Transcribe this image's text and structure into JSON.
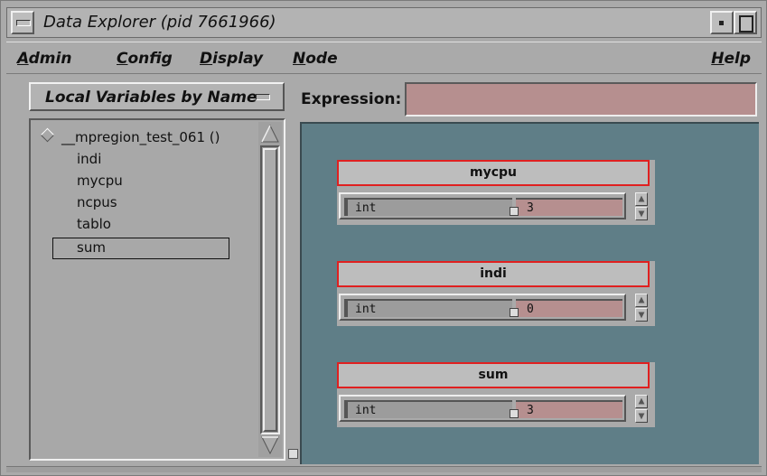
{
  "window": {
    "title": "Data Explorer (pid 7661966)"
  },
  "menubar": {
    "items": [
      {
        "mnemonic": "A",
        "rest": "dmin"
      },
      {
        "mnemonic": "C",
        "rest": "onfig"
      },
      {
        "mnemonic": "D",
        "rest": "isplay"
      },
      {
        "mnemonic": "N",
        "rest": "ode"
      },
      {
        "mnemonic": "H",
        "rest": "elp"
      }
    ]
  },
  "variables_panel": {
    "view_selector": "Local Variables by Name",
    "tree": {
      "root": "__mpregion_test_061 ()",
      "children": [
        "indi",
        "mycpu",
        "ncpus",
        "tablo",
        "sum"
      ],
      "selected": "sum"
    }
  },
  "expression": {
    "label": "Expression:",
    "value": ""
  },
  "watch_widgets": [
    {
      "name": "mycpu",
      "type": "int",
      "value": "3"
    },
    {
      "name": "indi",
      "type": "int",
      "value": "0"
    },
    {
      "name": "sum",
      "type": "int",
      "value": "3"
    }
  ],
  "icons": {
    "window_menu": "window-menu-icon",
    "minimize": "minimize-icon",
    "maximize": "maximize-icon",
    "tree_expand": "diamond-expand-icon",
    "scroll_up": "scroll-up-arrow-icon",
    "scroll_down": "scroll-down-arrow-icon",
    "spin_up": "spin-up-arrow-icon",
    "spin_down": "spin-down-arrow-icon"
  },
  "colors": {
    "window_bg": "#aaaaaa",
    "canvas_bg": "#5f7e87",
    "field_pink": "#b68f8f",
    "highlight_red": "#e02020"
  }
}
